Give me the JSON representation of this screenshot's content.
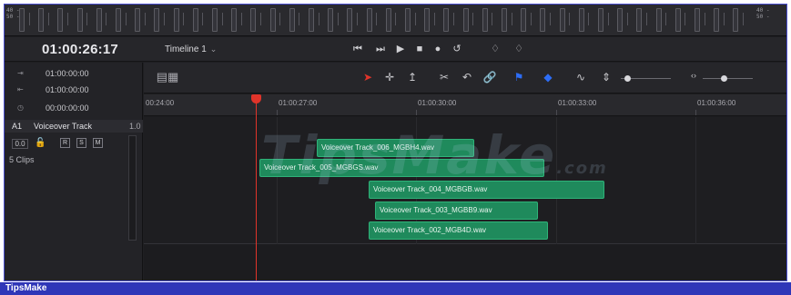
{
  "meter": {
    "left_scale": [
      "40 -",
      "50 -"
    ],
    "right_scale": [
      "40 -",
      "50 -"
    ]
  },
  "header": {
    "timecode": "01:00:26:17",
    "timeline_name": "Timeline 1",
    "transport": [
      "⏮",
      "⏭",
      "▶",
      "■",
      "●",
      "↺"
    ],
    "extra_icons": [
      "♢",
      "♢"
    ]
  },
  "left_panel": {
    "rows": [
      {
        "icon": "in-point-icon",
        "glyph": "⇥",
        "value": "01:00:00:00"
      },
      {
        "icon": "out-point-icon",
        "glyph": "⇤",
        "value": "01:00:00:00"
      },
      {
        "icon": "duration-icon",
        "glyph": "◷",
        "value": "00:00:00:00"
      }
    ],
    "track": {
      "id": "A1",
      "name": "Voiceover Track",
      "channels": "1.0"
    },
    "volume": "0.0",
    "buttons": [
      "R",
      "S",
      "M"
    ],
    "clips_count": "5 Clips"
  },
  "toolbar": {
    "tools": [
      "pointer-icon",
      "crosshair-icon",
      "trim-icon",
      "razor-icon",
      "undo-arc-icon",
      "link-icon",
      "flag-icon",
      "marker-icon",
      "waveform-icon",
      "zoom-icon"
    ]
  },
  "ruler": {
    "labels": [
      "00:24:00",
      "01:00:27:00",
      "01:00:30:00",
      "01:00:33:00",
      "01:00:36:00"
    ]
  },
  "clips": [
    {
      "name": "Voiceover Track_006_MGBH4.wav"
    },
    {
      "name": "Voiceover Track_005_MGBGS.wav"
    },
    {
      "name": "Voiceover Track_004_MGBGB.wav"
    },
    {
      "name": "Voiceover Track_003_MGBB9.wav"
    },
    {
      "name": "Voiceover Track_002_MGB4D.wav"
    }
  ],
  "watermark": {
    "text": "TipsMake",
    "suffix": ".com"
  },
  "footer": {
    "label": "TipsMake"
  },
  "colors": {
    "clip": "#1f8a5c",
    "playhead": "#e0342a",
    "footer": "#2f36b8",
    "accent_blue": "#2d6df6"
  }
}
